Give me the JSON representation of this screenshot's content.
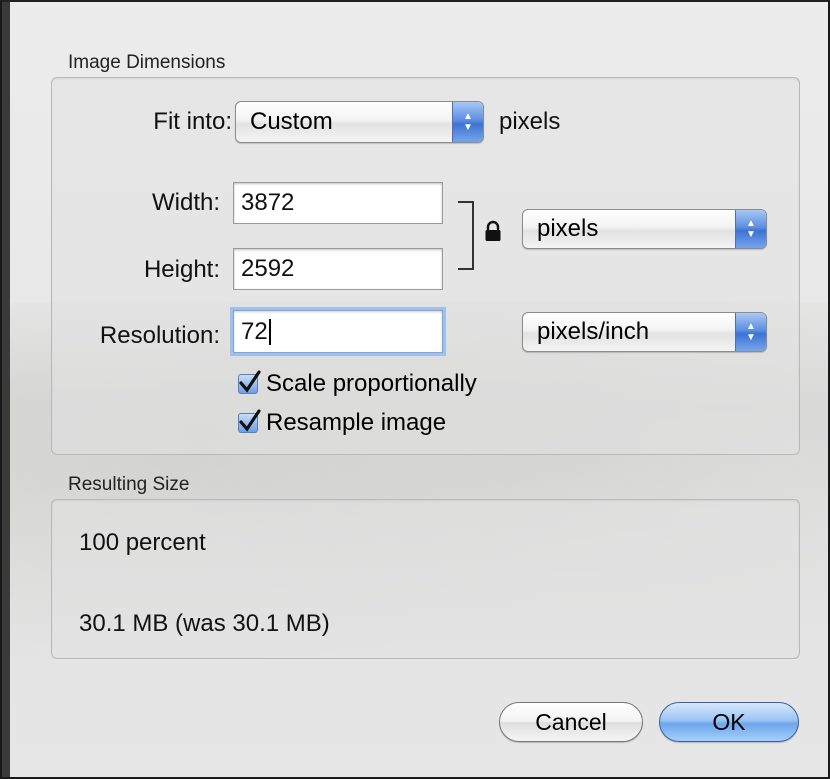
{
  "image_dimensions": {
    "section_title": "Image Dimensions",
    "fit_into": {
      "label": "Fit into:",
      "value": "Custom",
      "suffix": "pixels"
    },
    "width": {
      "label": "Width:",
      "value": "3872"
    },
    "height": {
      "label": "Height:",
      "value": "2592"
    },
    "size_unit": {
      "value": "pixels"
    },
    "resolution": {
      "label": "Resolution:",
      "value": "72"
    },
    "resolution_unit": {
      "value": "pixels/inch"
    },
    "scale_proportionally": {
      "label": "Scale proportionally",
      "checked": true
    },
    "resample_image": {
      "label": "Resample image",
      "checked": true
    },
    "constrain_lock": {
      "icon": "lock-icon"
    }
  },
  "resulting_size": {
    "section_title": "Resulting Size",
    "percent": "100 percent",
    "file_size": "30.1 MB (was 30.1 MB)"
  },
  "buttons": {
    "cancel": "Cancel",
    "ok": "OK"
  },
  "colors": {
    "accent_blue": "#4a7fd8",
    "focus_ring": "#9ec0ea"
  }
}
